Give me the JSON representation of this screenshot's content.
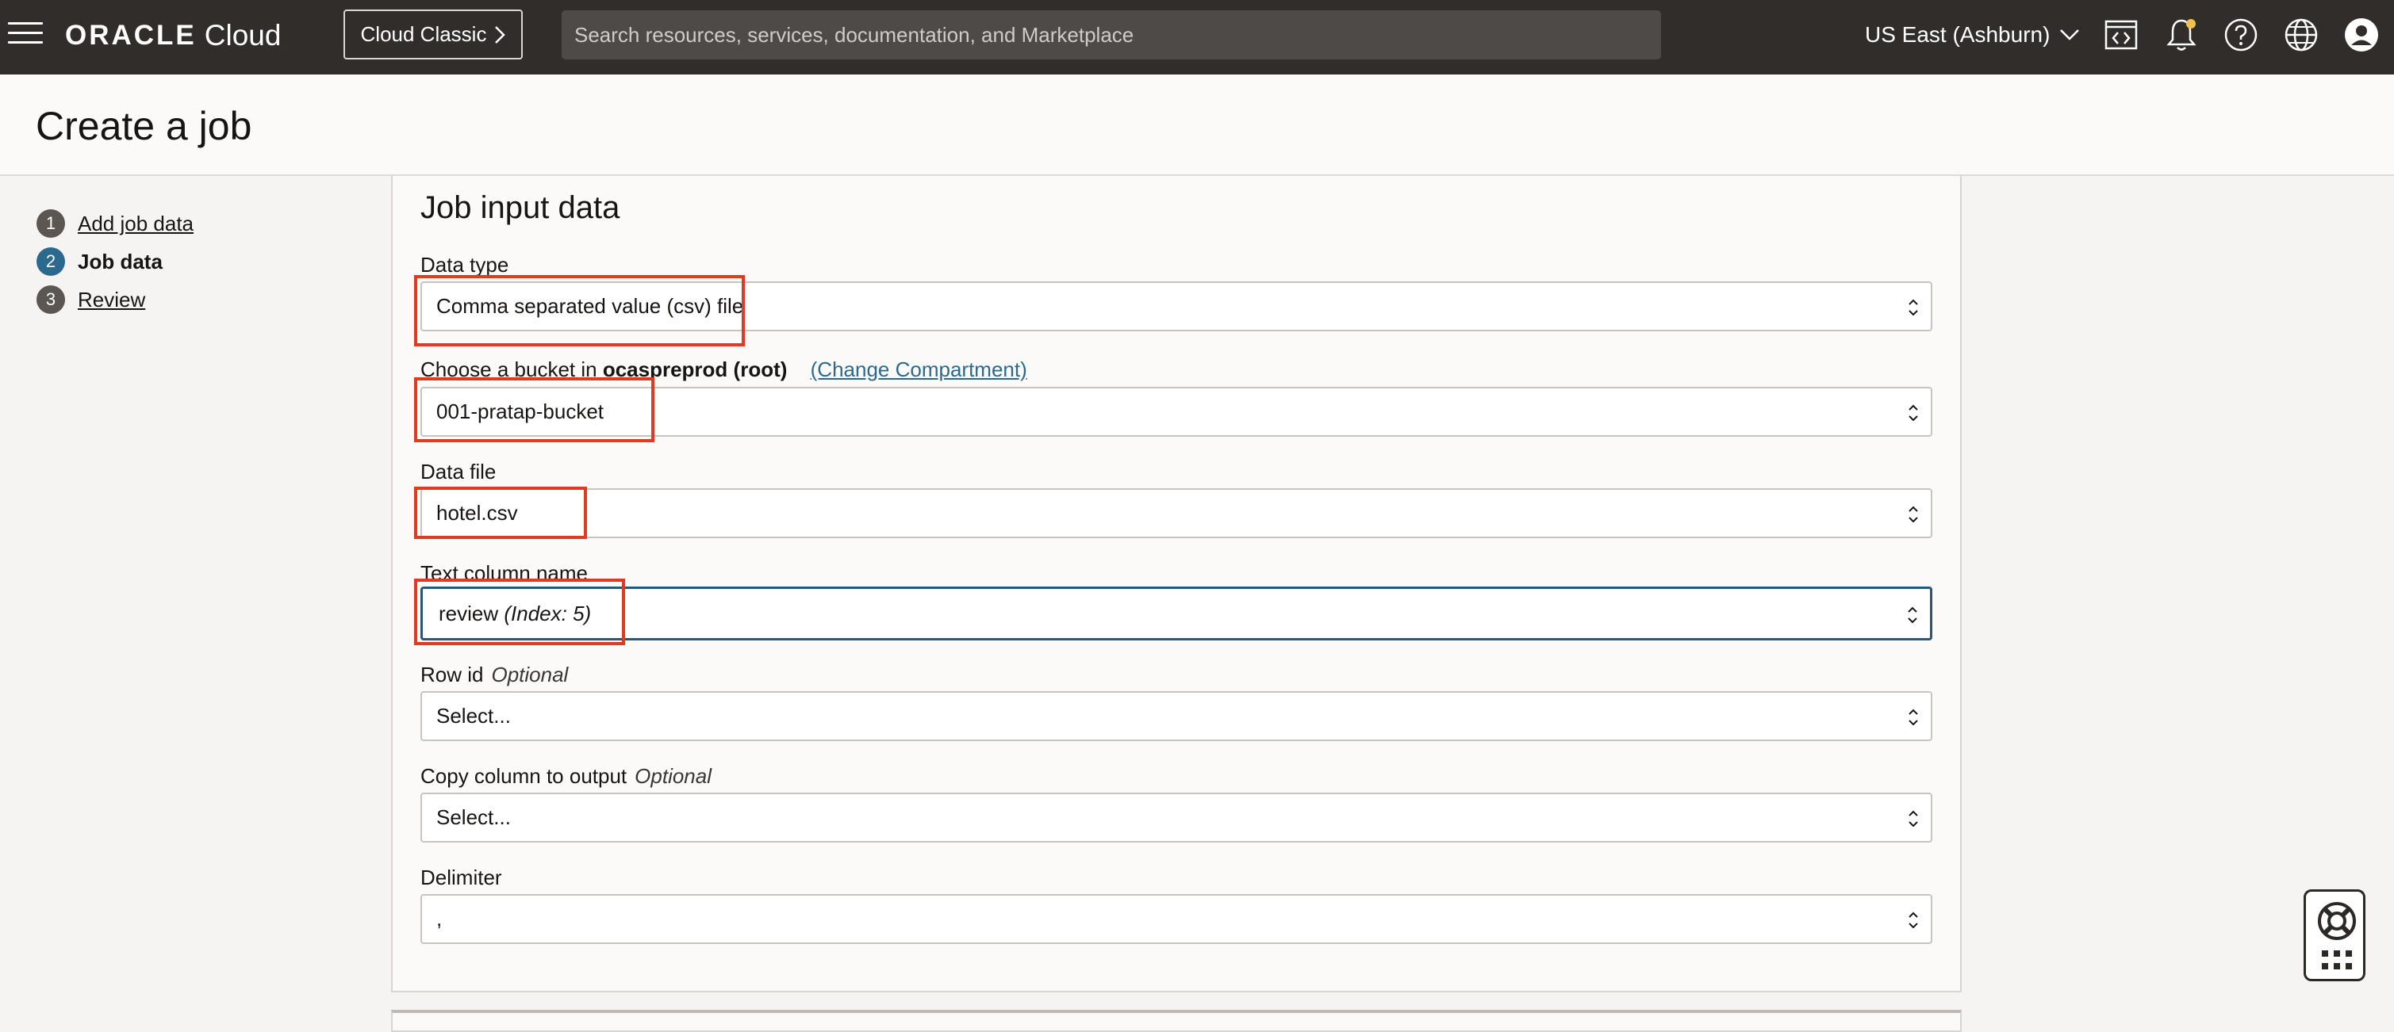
{
  "header": {
    "logo_oracle": "ORACLE",
    "logo_cloud": "Cloud",
    "classic_button": "Cloud Classic",
    "search_placeholder": "Search resources, services, documentation, and Marketplace",
    "region": "US East (Ashburn)",
    "icons": [
      "menu-icon",
      "chevron-right-icon",
      "chevron-down-icon",
      "code-editor-icon",
      "bell-icon",
      "help-icon",
      "globe-icon",
      "user-icon"
    ]
  },
  "page": {
    "title": "Create a job"
  },
  "steps": [
    {
      "num": "1",
      "label": "Add job data",
      "active": false
    },
    {
      "num": "2",
      "label": "Job data",
      "active": true
    },
    {
      "num": "3",
      "label": "Review",
      "active": false
    }
  ],
  "form": {
    "section_title": "Job input data",
    "data_type": {
      "label": "Data type",
      "value": "Comma separated value (csv) file"
    },
    "bucket": {
      "label_prefix": "Choose a bucket in",
      "compartment": "ocaspreprod (root)",
      "change_link": "(Change Compartment)",
      "value": "001-pratap-bucket"
    },
    "data_file": {
      "label": "Data file",
      "value": "hotel.csv"
    },
    "text_column": {
      "label": "Text column name",
      "value": "review",
      "index_note": "(Index: 5)"
    },
    "row_id": {
      "label": "Row id",
      "optional": "Optional",
      "value": "Select..."
    },
    "copy_column": {
      "label": "Copy column to output",
      "optional": "Optional",
      "value": "Select..."
    },
    "delimiter": {
      "label": "Delimiter",
      "value": ","
    }
  },
  "colors": {
    "header_bg": "#312d2a",
    "highlight": "#e03a23",
    "active_step": "#2b6a8e",
    "link": "#2b6a8e"
  },
  "help_icons": [
    "lifebuoy-icon",
    "apps-grid-icon"
  ]
}
